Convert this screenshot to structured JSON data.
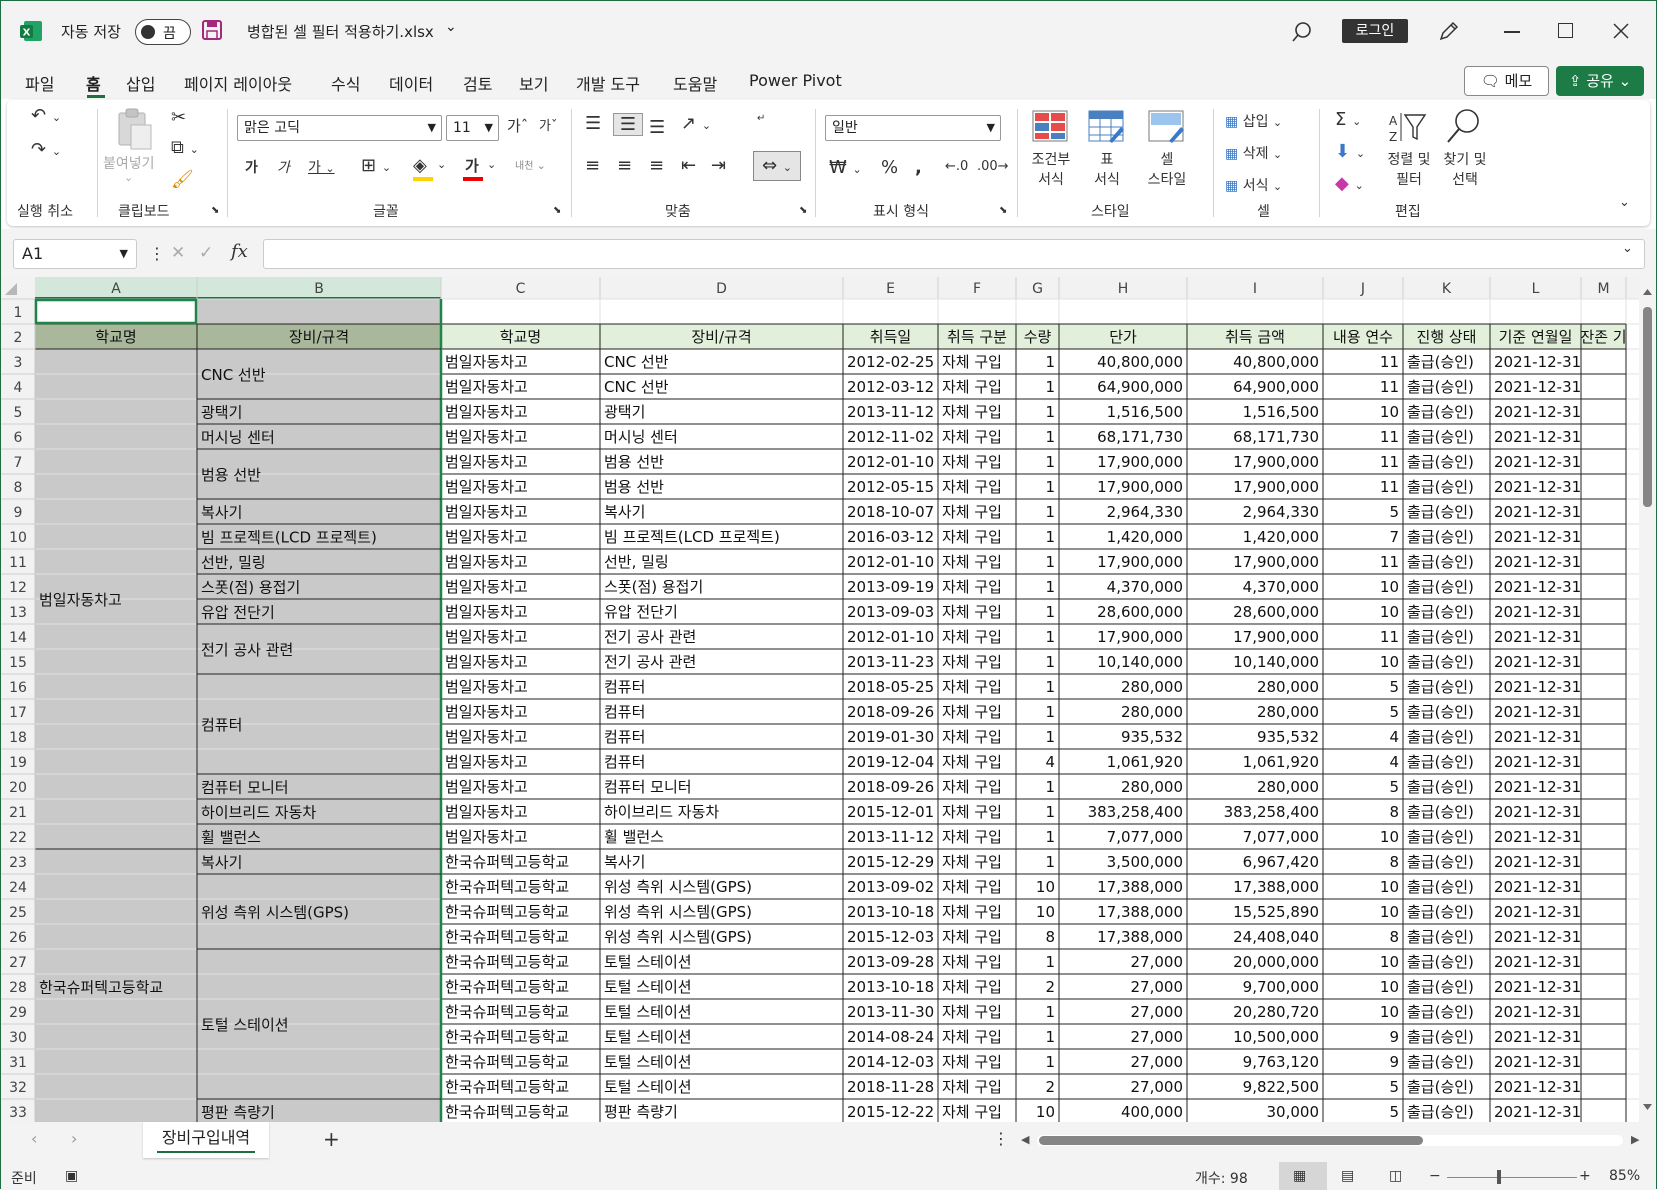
{
  "titlebar": {
    "autosave_label": "자동 저장",
    "toggle_state": "끔",
    "filename": "병합된 셀 필터 적용하기.xlsx",
    "login": "로그인"
  },
  "menu": {
    "tabs": [
      "파일",
      "홈",
      "삽입",
      "페이지 레이아웃",
      "수식",
      "데이터",
      "검토",
      "보기",
      "개발 도구",
      "도움말",
      "Power Pivot"
    ],
    "active": "홈",
    "memo": "메모",
    "share": "공유"
  },
  "ribbon": {
    "groups": [
      "실행 취소",
      "클립보드",
      "글꼴",
      "맞춤",
      "표시 형식",
      "스타일",
      "셀",
      "편집"
    ],
    "paste": "붙여넣기",
    "font_name": "맑은 고딕",
    "font_size": "11",
    "number_format": "일반",
    "wrap_text": "자동 줄 바꿈",
    "conditional_format": [
      "조건부",
      "서식"
    ],
    "table_format": [
      "표",
      "서식"
    ],
    "cell_style": [
      "셀",
      "스타일"
    ],
    "insert": "삽입",
    "delete": "삭제",
    "format": "서식",
    "sort_filter": [
      "정렬 및",
      "필터"
    ],
    "find_select": [
      "찾기 및",
      "선택"
    ]
  },
  "formula_bar": {
    "name_box": "A1",
    "formula": ""
  },
  "grid": {
    "columns": [
      "A",
      "B",
      "C",
      "D",
      "E",
      "F",
      "G",
      "H",
      "I",
      "J",
      "K",
      "L",
      "M"
    ],
    "headers": [
      "학교명",
      "장비/규격",
      "학교명",
      "장비/규격",
      "취득일",
      "취득 구분",
      "수량",
      "단가",
      "취득 금액",
      "내용 연수",
      "진행 상태",
      "기준 연월일",
      "잔존 기"
    ],
    "merged_a": [
      {
        "text": "범일자동차고",
        "from": 3,
        "to": 22
      },
      {
        "text": "한국슈퍼텍고등학교",
        "from": 23,
        "to": 33
      }
    ],
    "merged_b": [
      {
        "text": "CNC 선반",
        "from": 3,
        "to": 4
      },
      {
        "text": "광택기",
        "from": 5,
        "to": 5
      },
      {
        "text": "머시닝 센터",
        "from": 6,
        "to": 6
      },
      {
        "text": "범용 선반",
        "from": 7,
        "to": 8
      },
      {
        "text": "복사기",
        "from": 9,
        "to": 9
      },
      {
        "text": "빔 프로젝트(LCD 프로젝트)",
        "from": 10,
        "to": 10
      },
      {
        "text": "선반, 밀링",
        "from": 11,
        "to": 11
      },
      {
        "text": "스폿(점) 용접기",
        "from": 12,
        "to": 12
      },
      {
        "text": "유압 전단기",
        "from": 13,
        "to": 13
      },
      {
        "text": "전기 공사 관련",
        "from": 14,
        "to": 15
      },
      {
        "text": "컴퓨터",
        "from": 16,
        "to": 19
      },
      {
        "text": "컴퓨터 모니터",
        "from": 20,
        "to": 20
      },
      {
        "text": "하이브리드 자동차",
        "from": 21,
        "to": 21
      },
      {
        "text": "휠 밸런스",
        "from": 22,
        "to": 22
      },
      {
        "text": "복사기",
        "from": 23,
        "to": 23
      },
      {
        "text": "위성 측위 시스템(GPS)",
        "from": 24,
        "to": 26
      },
      {
        "text": "토털 스테이션",
        "from": 27,
        "to": 32
      },
      {
        "text": "평판 측량기",
        "from": 33,
        "to": 33
      }
    ],
    "rows": [
      [
        "범일자동차고",
        "CNC 선반",
        "2012-02-25",
        "자체 구입",
        "1",
        "40,800,000",
        "40,800,000",
        "11",
        "출급(승인)",
        "2021-12-31"
      ],
      [
        "범일자동차고",
        "CNC 선반",
        "2012-03-12",
        "자체 구입",
        "1",
        "64,900,000",
        "64,900,000",
        "11",
        "출급(승인)",
        "2021-12-31"
      ],
      [
        "범일자동차고",
        "광택기",
        "2013-11-12",
        "자체 구입",
        "1",
        "1,516,500",
        "1,516,500",
        "10",
        "출급(승인)",
        "2021-12-31"
      ],
      [
        "범일자동차고",
        "머시닝 센터",
        "2012-11-02",
        "자체 구입",
        "1",
        "68,171,730",
        "68,171,730",
        "11",
        "출급(승인)",
        "2021-12-31"
      ],
      [
        "범일자동차고",
        "범용 선반",
        "2012-01-10",
        "자체 구입",
        "1",
        "17,900,000",
        "17,900,000",
        "11",
        "출급(승인)",
        "2021-12-31"
      ],
      [
        "범일자동차고",
        "범용 선반",
        "2012-05-15",
        "자체 구입",
        "1",
        "17,900,000",
        "17,900,000",
        "11",
        "출급(승인)",
        "2021-12-31"
      ],
      [
        "범일자동차고",
        "복사기",
        "2018-10-07",
        "자체 구입",
        "1",
        "2,964,330",
        "2,964,330",
        "5",
        "출급(승인)",
        "2021-12-31"
      ],
      [
        "범일자동차고",
        "빔 프로젝트(LCD 프로젝트)",
        "2016-03-12",
        "자체 구입",
        "1",
        "1,420,000",
        "1,420,000",
        "7",
        "출급(승인)",
        "2021-12-31"
      ],
      [
        "범일자동차고",
        "선반, 밀링",
        "2012-01-10",
        "자체 구입",
        "1",
        "17,900,000",
        "17,900,000",
        "11",
        "출급(승인)",
        "2021-12-31"
      ],
      [
        "범일자동차고",
        "스폿(점) 용접기",
        "2013-09-19",
        "자체 구입",
        "1",
        "4,370,000",
        "4,370,000",
        "10",
        "출급(승인)",
        "2021-12-31"
      ],
      [
        "범일자동차고",
        "유압 전단기",
        "2013-09-03",
        "자체 구입",
        "1",
        "28,600,000",
        "28,600,000",
        "10",
        "출급(승인)",
        "2021-12-31"
      ],
      [
        "범일자동차고",
        "전기 공사 관련",
        "2012-01-10",
        "자체 구입",
        "1",
        "17,900,000",
        "17,900,000",
        "11",
        "출급(승인)",
        "2021-12-31"
      ],
      [
        "범일자동차고",
        "전기 공사 관련",
        "2013-11-23",
        "자체 구입",
        "1",
        "10,140,000",
        "10,140,000",
        "10",
        "출급(승인)",
        "2021-12-31"
      ],
      [
        "범일자동차고",
        "컴퓨터",
        "2018-05-25",
        "자체 구입",
        "1",
        "280,000",
        "280,000",
        "5",
        "출급(승인)",
        "2021-12-31"
      ],
      [
        "범일자동차고",
        "컴퓨터",
        "2018-09-26",
        "자체 구입",
        "1",
        "280,000",
        "280,000",
        "5",
        "출급(승인)",
        "2021-12-31"
      ],
      [
        "범일자동차고",
        "컴퓨터",
        "2019-01-30",
        "자체 구입",
        "1",
        "935,532",
        "935,532",
        "4",
        "출급(승인)",
        "2021-12-31"
      ],
      [
        "범일자동차고",
        "컴퓨터",
        "2019-12-04",
        "자체 구입",
        "4",
        "1,061,920",
        "1,061,920",
        "4",
        "출급(승인)",
        "2021-12-31"
      ],
      [
        "범일자동차고",
        "컴퓨터 모니터",
        "2018-09-26",
        "자체 구입",
        "1",
        "280,000",
        "280,000",
        "5",
        "출급(승인)",
        "2021-12-31"
      ],
      [
        "범일자동차고",
        "하이브리드 자동차",
        "2015-12-01",
        "자체 구입",
        "1",
        "383,258,400",
        "383,258,400",
        "8",
        "출급(승인)",
        "2021-12-31"
      ],
      [
        "범일자동차고",
        "휠 밸런스",
        "2013-11-12",
        "자체 구입",
        "1",
        "7,077,000",
        "7,077,000",
        "10",
        "출급(승인)",
        "2021-12-31"
      ],
      [
        "한국슈퍼텍고등학교",
        "복사기",
        "2015-12-29",
        "자체 구입",
        "1",
        "3,500,000",
        "6,967,420",
        "8",
        "출급(승인)",
        "2021-12-31"
      ],
      [
        "한국슈퍼텍고등학교",
        "위성 측위 시스템(GPS)",
        "2013-09-02",
        "자체 구입",
        "10",
        "17,388,000",
        "17,388,000",
        "10",
        "출급(승인)",
        "2021-12-31"
      ],
      [
        "한국슈퍼텍고등학교",
        "위성 측위 시스템(GPS)",
        "2013-10-18",
        "자체 구입",
        "10",
        "17,388,000",
        "15,525,890",
        "10",
        "출급(승인)",
        "2021-12-31"
      ],
      [
        "한국슈퍼텍고등학교",
        "위성 측위 시스템(GPS)",
        "2015-12-03",
        "자체 구입",
        "8",
        "17,388,000",
        "24,408,040",
        "8",
        "출급(승인)",
        "2021-12-31"
      ],
      [
        "한국슈퍼텍고등학교",
        "토털 스테이션",
        "2013-09-28",
        "자체 구입",
        "1",
        "27,000",
        "20,000,000",
        "10",
        "출급(승인)",
        "2021-12-31"
      ],
      [
        "한국슈퍼텍고등학교",
        "토털 스테이션",
        "2013-10-18",
        "자체 구입",
        "2",
        "27,000",
        "9,700,000",
        "10",
        "출급(승인)",
        "2021-12-31"
      ],
      [
        "한국슈퍼텍고등학교",
        "토털 스테이션",
        "2013-11-30",
        "자체 구입",
        "1",
        "27,000",
        "20,280,720",
        "10",
        "출급(승인)",
        "2021-12-31"
      ],
      [
        "한국슈퍼텍고등학교",
        "토털 스테이션",
        "2014-08-24",
        "자체 구입",
        "1",
        "27,000",
        "10,500,000",
        "9",
        "출급(승인)",
        "2021-12-31"
      ],
      [
        "한국슈퍼텍고등학교",
        "토털 스테이션",
        "2014-12-03",
        "자체 구입",
        "1",
        "27,000",
        "9,763,120",
        "9",
        "출급(승인)",
        "2021-12-31"
      ],
      [
        "한국슈퍼텍고등학교",
        "토털 스테이션",
        "2018-11-28",
        "자체 구입",
        "2",
        "27,000",
        "9,822,500",
        "5",
        "출급(승인)",
        "2021-12-31"
      ],
      [
        "한국슈퍼텍고등학교",
        "평판 측량기",
        "2015-12-22",
        "자체 구입",
        "10",
        "400,000",
        "30,000",
        "5",
        "출급(승인)",
        "2021-12-31"
      ]
    ]
  },
  "sheets": {
    "active": "장비구입내역"
  },
  "status": {
    "ready": "준비",
    "count": "개수: 98",
    "zoom": "85%"
  },
  "colors": {
    "excel_green": "#1d6f42",
    "header_fill": "#e2efda",
    "merged_fill": "#c9c9c9"
  }
}
